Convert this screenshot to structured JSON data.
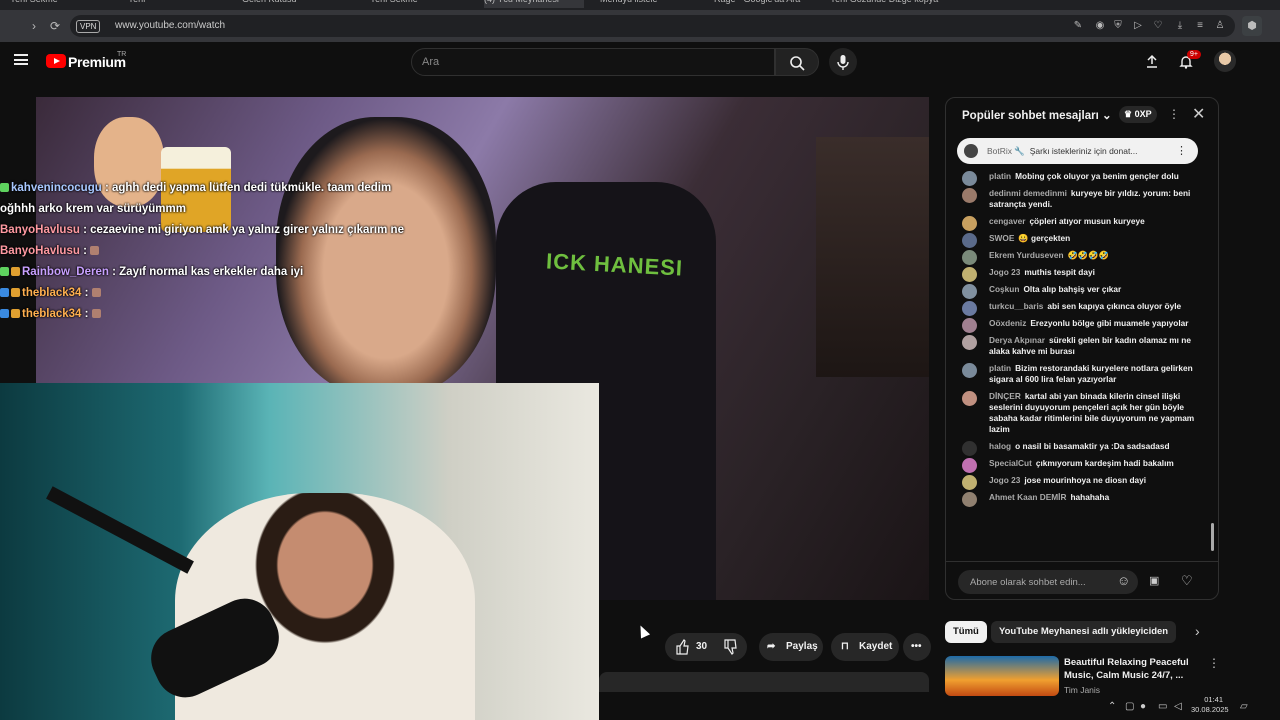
{
  "browser": {
    "tabs": [
      "Yeni Sekme",
      "Yeni",
      "Gelen Kutusu",
      "Yeni Sekme",
      "(4) Ycu Meyhanesi",
      "Menüyü listele",
      "Rage - Google'da Ara",
      "Yeni Gözünde Dizge kopya"
    ],
    "vpn_label": "VPN",
    "url": "www.youtube.com/watch"
  },
  "youtube": {
    "brand": "Premium",
    "region": "TR",
    "search_placeholder": "Ara",
    "notification_count": "9+"
  },
  "stream_overlay_chat": [
    {
      "name": "kahvenincocugu",
      "text": "aghh dedi yapma lütfen dedi tükmükle. taam dedim",
      "cls": "n1"
    },
    {
      "name": "",
      "text": "oğhhh arko krem var sürüyümmm",
      "cls": ""
    },
    {
      "name": "BanyoHavlusu",
      "text": "cezaevine mi giriyon amk ya yalnız girer yalnız çıkarım ne",
      "cls": "n2"
    },
    {
      "name": "BanyoHavlusu",
      "text": "",
      "cls": "n2"
    },
    {
      "name": "Rainbow_Deren",
      "text": "Zayıf normal kas erkekler daha iyi",
      "cls": "n3"
    },
    {
      "name": "theblack34",
      "text": "",
      "cls": "n4"
    },
    {
      "name": "theblack34",
      "text": "",
      "cls": "n4"
    }
  ],
  "video_overlay_text": "ICK HANESI",
  "actions": {
    "like_count": "30",
    "share_label": "Paylaş",
    "save_label": "Kaydet"
  },
  "chat_panel": {
    "title": "Popüler sohbet mesajları",
    "xp": "0XP",
    "pinned_author": "BotRix 🔧",
    "pinned_text": "Şarkı istekleriniz için donat...",
    "messages": [
      {
        "author": "platin",
        "text": "Mobing çok oluyor ya benim gençler dolu",
        "color": "#7a8a9a"
      },
      {
        "author": "dedinmi demedinmi",
        "text": "kuryeye bir yıldız. yorum: beni satrançta yendi.",
        "color": "#9a7a6a"
      },
      {
        "author": "cengaver",
        "text": "çöpleri atıyor musun kuryeye",
        "color": "#c8a060"
      },
      {
        "author": "SWOE",
        "text": "😀 gerçekten",
        "color": "#5a6a8a"
      },
      {
        "author": "Ekrem Yurduseven",
        "text": "🤣🤣🤣🤣",
        "color": "#7a8a7a"
      },
      {
        "author": "Jogo 23",
        "text": "muthis tespit dayi",
        "color": "#c0b070"
      },
      {
        "author": "Coşkun",
        "text": "Olta alıp bahşiş ver çıkar",
        "color": "#8090a0"
      },
      {
        "author": "turkcu__baris",
        "text": "abi sen kapıya çıkınca oluyor öyle",
        "color": "#6a7aa0"
      },
      {
        "author": "Oöxdeniz",
        "text": "Erezyonlu bölge gibi muamele yapıyolar",
        "color": "#a08090"
      },
      {
        "author": "Derya Akpınar",
        "text": "sürekli gelen bir kadın olamaz mı ne alaka kahve mi burası",
        "color": "#b0a0a0"
      },
      {
        "author": "platin",
        "text": "Bizim restorandaki kuryelere notlara gelirken sigara al 600 lira felan yazıyorlar",
        "color": "#7a8a9a"
      },
      {
        "author": "DİNÇER",
        "text": "kartal abi yan binada kilerin cinsel ilişki seslerini duyuyorum pençeleri açık her gün böyle sabaha kadar ritimlerini bile duyuyorum ne yapmam lazim",
        "color": "#c09080"
      },
      {
        "author": "halog",
        "text": "o nasil bi basamaktir ya :Da sadsadasd",
        "color": "#303030"
      },
      {
        "author": "SpecialCut",
        "text": "çıkmıyorum kardeşim hadi bakalım",
        "color": "#c070b0"
      },
      {
        "author": "Jogo 23",
        "text": "jose mourinhoya ne diosn dayi",
        "color": "#c0b070"
      },
      {
        "author": "Ahmet Kaan DEMİR",
        "text": "hahahaha",
        "color": "#908070"
      }
    ],
    "input_placeholder": "Abone olarak sohbet edin..."
  },
  "chips": [
    "Tümü",
    "YouTube Meyhanesi adlı yükleyiciden"
  ],
  "recommendation": {
    "title": "Beautiful Relaxing Peaceful Music, Calm Music 24/7, ...",
    "channel": "Tim Janis"
  },
  "taskbar": {
    "time": "01:41",
    "date": "30.08.2025"
  }
}
